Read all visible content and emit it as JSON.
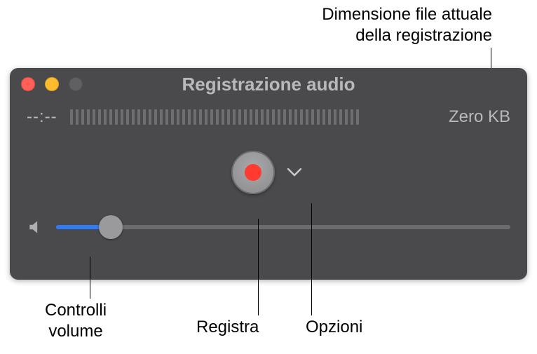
{
  "callouts": {
    "filesize_label_line1": "Dimensione file attuale",
    "filesize_label_line2": "della registrazione",
    "volume_label_line1": "Controlli",
    "volume_label_line2": "volume",
    "record_label": "Registra",
    "options_label": "Opzioni"
  },
  "window": {
    "title": "Registrazione audio",
    "timecode": "--:--",
    "filesize": "Zero KB",
    "level_ticks": 52,
    "volume_percent": 12
  }
}
